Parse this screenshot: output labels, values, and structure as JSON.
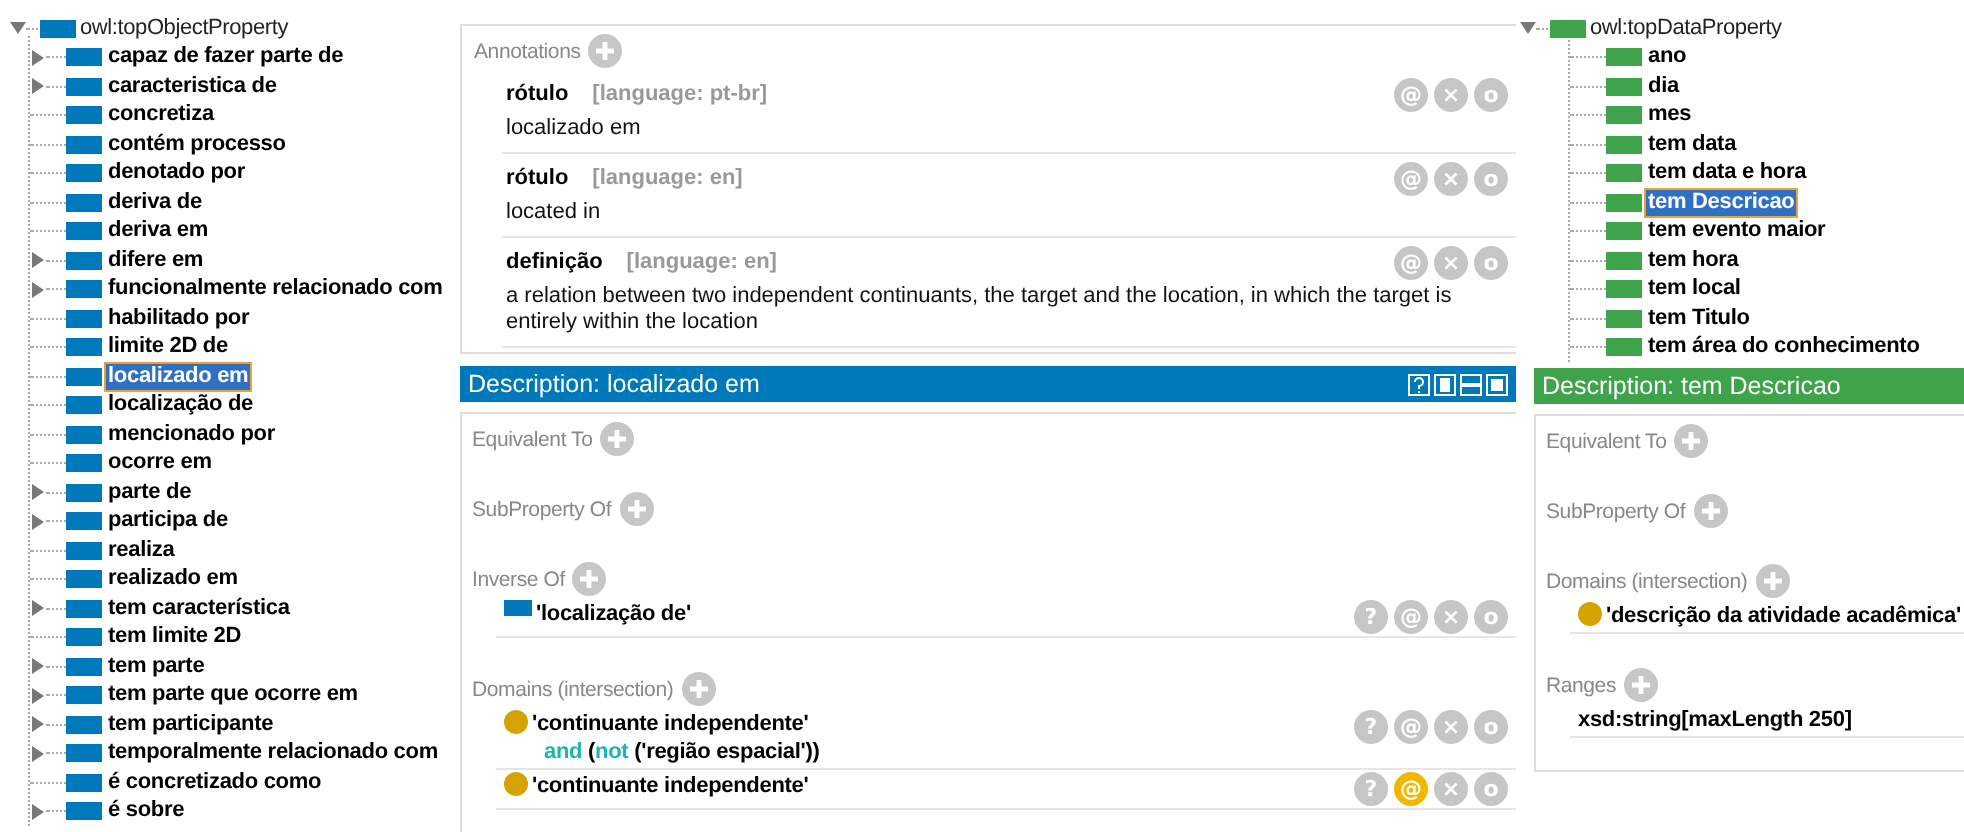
{
  "object_property_tree": {
    "root": {
      "label": "owl:topObjectProperty",
      "expanded": true
    },
    "items": [
      {
        "label": "capaz de fazer parte de",
        "expandable": true,
        "selected": false
      },
      {
        "label": "caracteristica de",
        "expandable": true,
        "selected": false
      },
      {
        "label": "concretiza",
        "expandable": false,
        "selected": false
      },
      {
        "label": "contém processo",
        "expandable": false,
        "selected": false
      },
      {
        "label": "denotado por",
        "expandable": false,
        "selected": false
      },
      {
        "label": "deriva de",
        "expandable": false,
        "selected": false
      },
      {
        "label": "deriva em",
        "expandable": false,
        "selected": false
      },
      {
        "label": "difere em",
        "expandable": true,
        "selected": false
      },
      {
        "label": "funcionalmente relacionado com",
        "expandable": true,
        "selected": false
      },
      {
        "label": "habilitado por",
        "expandable": false,
        "selected": false
      },
      {
        "label": "limite 2D de",
        "expandable": false,
        "selected": false
      },
      {
        "label": "localizado em",
        "expandable": false,
        "selected": true
      },
      {
        "label": "localização de",
        "expandable": false,
        "selected": false
      },
      {
        "label": "mencionado por",
        "expandable": false,
        "selected": false
      },
      {
        "label": "ocorre em",
        "expandable": false,
        "selected": false
      },
      {
        "label": "parte de",
        "expandable": true,
        "selected": false
      },
      {
        "label": "participa de",
        "expandable": true,
        "selected": false
      },
      {
        "label": "realiza",
        "expandable": false,
        "selected": false
      },
      {
        "label": "realizado em",
        "expandable": false,
        "selected": false
      },
      {
        "label": "tem característica",
        "expandable": true,
        "selected": false
      },
      {
        "label": "tem limite 2D",
        "expandable": false,
        "selected": false
      },
      {
        "label": "tem parte",
        "expandable": true,
        "selected": false
      },
      {
        "label": "tem parte que ocorre em",
        "expandable": true,
        "selected": false
      },
      {
        "label": "tem participante",
        "expandable": true,
        "selected": false
      },
      {
        "label": "temporalmente relacionado com",
        "expandable": true,
        "selected": false
      },
      {
        "label": "é concretizado como",
        "expandable": false,
        "selected": false
      },
      {
        "label": "é sobre",
        "expandable": true,
        "selected": false
      }
    ]
  },
  "object_description": {
    "annotations_title": "Annotations",
    "annotations": [
      {
        "property": "rótulo",
        "language": "[language: pt-br]",
        "value": "localizado em",
        "buttons": [
          {
            "glyph": "@",
            "active": false
          },
          {
            "glyph": "×",
            "active": false
          },
          {
            "glyph": "o",
            "active": false
          }
        ]
      },
      {
        "property": "rótulo",
        "language": "[language: en]",
        "value": "located in",
        "buttons": [
          {
            "glyph": "@",
            "active": false
          },
          {
            "glyph": "×",
            "active": false
          },
          {
            "glyph": "o",
            "active": false
          }
        ]
      },
      {
        "property": "definição",
        "language": "[language: en]",
        "value": "a relation between two independent continuants, the target and the location, in which the target is entirely within the location",
        "buttons": [
          {
            "glyph": "@",
            "active": false
          },
          {
            "glyph": "×",
            "active": false
          },
          {
            "glyph": "o",
            "active": false
          }
        ]
      }
    ],
    "header": "Description: localizado em",
    "kind": "object",
    "sections": [
      {
        "title": "Equivalent To"
      },
      {
        "title": "SubProperty Of"
      },
      {
        "title": "Inverse Of",
        "items": [
          {
            "kind": "property",
            "lines": [
              [
                {
                  "text": "'localização de'",
                  "keyword": false
                }
              ]
            ],
            "buttons": [
              {
                "glyph": "?",
                "active": false
              },
              {
                "glyph": "@",
                "active": false
              },
              {
                "glyph": "×",
                "active": false
              },
              {
                "glyph": "o",
                "active": false
              }
            ]
          }
        ]
      },
      {
        "title": "Domains (intersection)",
        "items": [
          {
            "kind": "class",
            "lines": [
              [
                {
                  "text": "'continuante independente'",
                  "keyword": false
                }
              ],
              [
                {
                  "text": "and",
                  "keyword": true
                },
                {
                  "text": " (",
                  "keyword": false
                },
                {
                  "text": "not",
                  "keyword": true
                },
                {
                  "text": " ('região espacial'))",
                  "keyword": false
                }
              ]
            ],
            "buttons": [
              {
                "glyph": "?",
                "active": false
              },
              {
                "glyph": "@",
                "active": false
              },
              {
                "glyph": "×",
                "active": false
              },
              {
                "glyph": "o",
                "active": false
              }
            ]
          },
          {
            "kind": "class",
            "lines": [
              [
                {
                  "text": "'continuante independente'",
                  "keyword": false
                }
              ]
            ],
            "buttons": [
              {
                "glyph": "?",
                "active": false
              },
              {
                "glyph": "@",
                "active": true
              },
              {
                "glyph": "×",
                "active": false
              },
              {
                "glyph": "o",
                "active": false
              }
            ]
          }
        ]
      }
    ]
  },
  "data_property_tree": {
    "root": {
      "label": "owl:topDataProperty",
      "expanded": true
    },
    "items": [
      {
        "label": "ano",
        "expandable": false,
        "selected": false
      },
      {
        "label": "dia",
        "expandable": false,
        "selected": false
      },
      {
        "label": "mes",
        "expandable": false,
        "selected": false
      },
      {
        "label": "tem data",
        "expandable": false,
        "selected": false
      },
      {
        "label": "tem data e hora",
        "expandable": false,
        "selected": false
      },
      {
        "label": "tem Descricao",
        "expandable": false,
        "selected": true
      },
      {
        "label": "tem evento maior",
        "expandable": false,
        "selected": false
      },
      {
        "label": "tem hora",
        "expandable": false,
        "selected": false
      },
      {
        "label": "tem local",
        "expandable": false,
        "selected": false
      },
      {
        "label": "tem Titulo",
        "expandable": false,
        "selected": false
      },
      {
        "label": "tem área do conhecimento",
        "expandable": false,
        "selected": false
      }
    ]
  },
  "data_description": {
    "header": "Description: tem Descricao",
    "kind": "data",
    "sections": [
      {
        "title": "Equivalent To"
      },
      {
        "title": "SubProperty Of"
      },
      {
        "title": "Domains (intersection)",
        "items": [
          {
            "kind": "class",
            "lines": [
              [
                {
                  "text": "'descrição da atividade acadêmica'",
                  "keyword": false
                }
              ]
            ]
          }
        ]
      },
      {
        "title": "Ranges",
        "items": [
          {
            "kind": "datatype",
            "lines": [
              [
                {
                  "text": "xsd:string[maxLength 250]",
                  "keyword": false
                }
              ]
            ]
          }
        ]
      }
    ]
  }
}
